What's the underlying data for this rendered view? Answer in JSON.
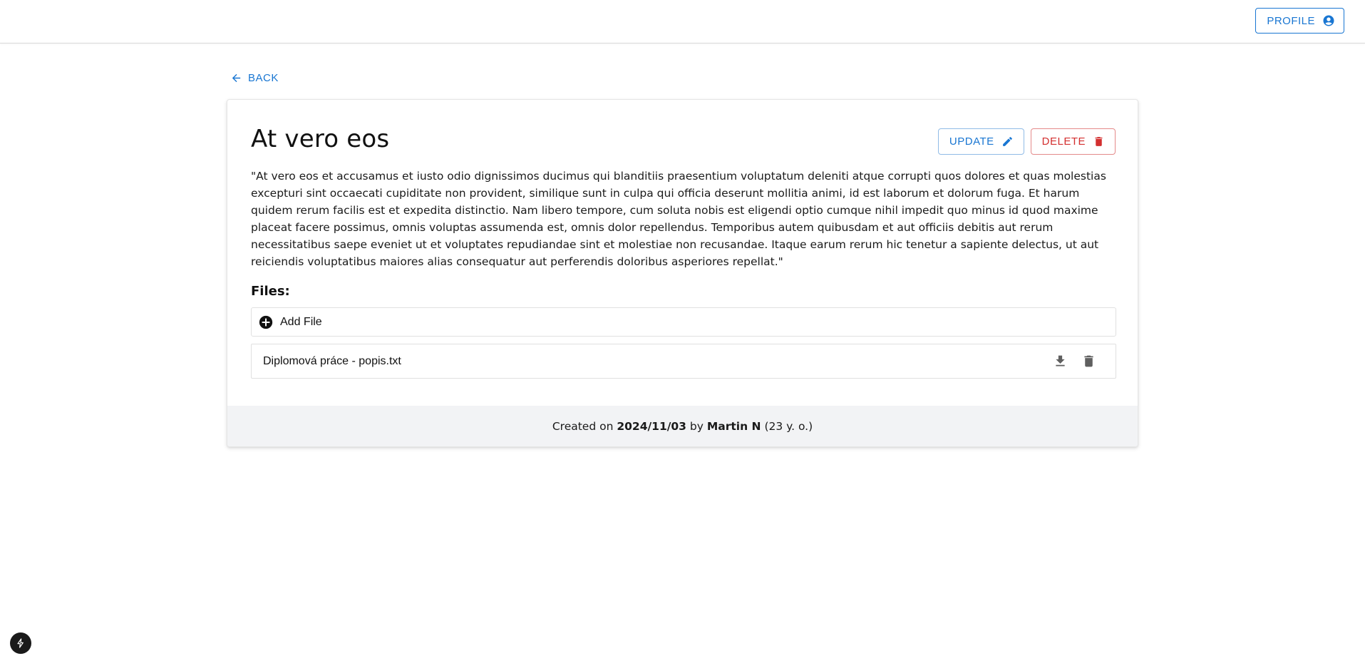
{
  "header": {
    "profile_label": "PROFILE"
  },
  "nav": {
    "back_label": "BACK"
  },
  "post": {
    "title": "At vero eos",
    "description": "\"At vero eos et accusamus et iusto odio dignissimos ducimus qui blanditiis praesentium voluptatum deleniti atque corrupti quos dolores et quas molestias excepturi sint occaecati cupiditate non provident, similique sunt in culpa qui officia deserunt mollitia animi, id est laborum et dolorum fuga. Et harum quidem rerum facilis est et expedita distinctio. Nam libero tempore, cum soluta nobis est eligendi optio cumque nihil impedit quo minus id quod maxime placeat facere possimus, omnis voluptas assumenda est, omnis dolor repellendus. Temporibus autem quibusdam et aut officiis debitis aut rerum necessitatibus saepe eveniet ut et voluptates repudiandae sint et molestiae non recusandae. Itaque earum rerum hic tenetur a sapiente delectus, ut aut reiciendis voluptatibus maiores alias consequatur aut perferendis doloribus asperiores repellat.\"",
    "update_label": "UPDATE",
    "delete_label": "DELETE"
  },
  "files": {
    "heading": "Files:",
    "add_label": "Add File",
    "items": [
      {
        "name": "Diplomová práce - popis.txt"
      }
    ]
  },
  "footer": {
    "created_prefix": "Created on",
    "date": "2024/11/03",
    "by_text": "by",
    "author": "Martin N",
    "age": "(23 y. o.)"
  },
  "icons": {
    "profile": "account-circle-icon",
    "back": "arrow-left-icon",
    "update": "pencil-icon",
    "delete": "trash-icon",
    "add_file": "plus-circle-icon",
    "download": "download-icon",
    "file_delete": "trash-icon",
    "dev_badge": "bolt-icon"
  },
  "colors": {
    "primary": "#1976d2",
    "danger": "#d32f2f",
    "footer_bg": "#f2f3f5"
  }
}
